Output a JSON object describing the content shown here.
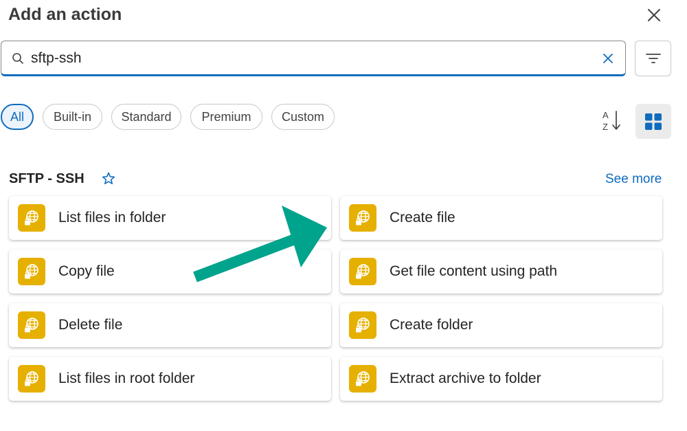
{
  "panel": {
    "title": "Add an action"
  },
  "search": {
    "value": "sftp-ssh"
  },
  "filters": {
    "chips": [
      {
        "label": "All",
        "selected": true
      },
      {
        "label": "Built-in",
        "selected": false
      },
      {
        "label": "Standard",
        "selected": false
      },
      {
        "label": "Premium",
        "selected": false
      },
      {
        "label": "Custom",
        "selected": false
      }
    ],
    "sort_icon_letters": {
      "top": "A",
      "bottom": "Z"
    }
  },
  "group": {
    "title": "SFTP - SSH",
    "see_more": "See more",
    "actions": [
      {
        "label": "List files in folder"
      },
      {
        "label": "Create file"
      },
      {
        "label": "Copy file"
      },
      {
        "label": "Get file content using path"
      },
      {
        "label": "Delete file"
      },
      {
        "label": "Create folder"
      },
      {
        "label": "List files in root folder"
      },
      {
        "label": "Extract archive to folder"
      }
    ]
  },
  "colors": {
    "accent": "#0f6cbd",
    "connector_icon": "#e6b000",
    "annotation_arrow": "#00a38c"
  },
  "icons": {
    "close": "close-icon",
    "search": "search-icon",
    "clear": "dismiss-icon",
    "filter": "filter-lines-icon",
    "sort": "sort-az-icon",
    "view": "grid-view-icon",
    "favorite": "star-outline-icon",
    "connector": "globe-lock-icon"
  }
}
